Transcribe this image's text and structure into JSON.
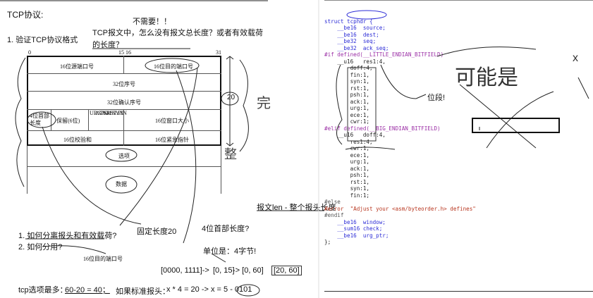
{
  "left": {
    "heading": "TCP协议:",
    "item1": "1. 验证TCP协议格式",
    "question_no_len": "TCP报文中，怎么没有报文总长度？或者有效载荷的长度？",
    "question_no_len_l1": "TCP报文中，怎么没有报文总长度？或者有效载荷",
    "question_no_len_l2": "的长度？",
    "not_needed": "不需要！！",
    "bit0": "0",
    "bit15": "15",
    "bit16": "16",
    "bit31": "31",
    "fields": {
      "src_port": "16位源端口号",
      "dst_port": "16位目的端口号",
      "seq": "32位序号",
      "ack": "32位确认序号",
      "hdr_len": "4位首部长度",
      "reserved": "保留(6位)",
      "flag_col1": "URG",
      "flag_col2": "ACK",
      "flag_col3": "PSH",
      "flag_col4": "RST",
      "flag_col5": "SYN",
      "flag_col6": "FIN",
      "window": "16位窗口大小",
      "checksum": "16位校验和",
      "urgent": "16位紧急指针",
      "options": "选项",
      "data": "数据"
    },
    "note_20": "20",
    "q1": "1. 如何分离报头和有效载荷?",
    "q2": "2. 如何分用?",
    "dst_port_again": "16位目的端口号",
    "fixed_len": "固定长度20",
    "hdr4": "4位首部长度?",
    "unit": "单位是：4字节!",
    "range": "[0000, 1111] -> [0, 15] -> [0, 60] -> [20, 60]",
    "range_a": "[0000, 1111]->",
    "range_b": "[0, 15]",
    "range_c": "->  [0, 60]",
    "range_d": "[20, 60]",
    "options_max": "tcp选项最多：60-20 = 40；",
    "options_max_label": "tcp选项最多：",
    "options_max_val": "60-20 = 40；",
    "std_header": "如果标准报头：x * 4 = 20 -> x = 5 -> 0101",
    "std_label": "如果标准报头：",
    "std_val": "x * 4 = 20 -> x = 5 - 0101",
    "len_note": "报文len - 整个报头长度",
    "hand_wan": "完",
    "hand_zheng": "整"
  },
  "right": {
    "lines": [
      "struct tcphdr {",
      "    __be16  source;",
      "    __be16  dest;",
      "    __be32  seq;",
      "    __be32  ack_seq;",
      "#if defined(__LITTLE_ENDIAN_BITFIELD)",
      "    __u16   res1:4,",
      "        doff:4,",
      "        fin:1,",
      "        syn:1,",
      "        rst:1,",
      "        psh:1,",
      "        ack:1,",
      "        urg:1,",
      "        ece:1,",
      "        cwr:1;",
      "#elif defined(__BIG_ENDIAN_BITFIELD)",
      "    __u16   doff:4,",
      "        res1:4,",
      "        cwr:1,",
      "        ece:1,",
      "        urg:1,",
      "        ack:1,",
      "        psh:1,",
      "        rst:1,",
      "        syn:1,",
      "        fin:1;",
      "#else",
      "#error  \"Adjust your <asm/byteorder.h> defines\"",
      "#endif",
      "    __be16  window;",
      "    __sum16 check;",
      "    __be16  urg_ptr;",
      "};"
    ],
    "bitfield_note": "位段!",
    "hand_a": "可能是",
    "hand_b": "x"
  }
}
